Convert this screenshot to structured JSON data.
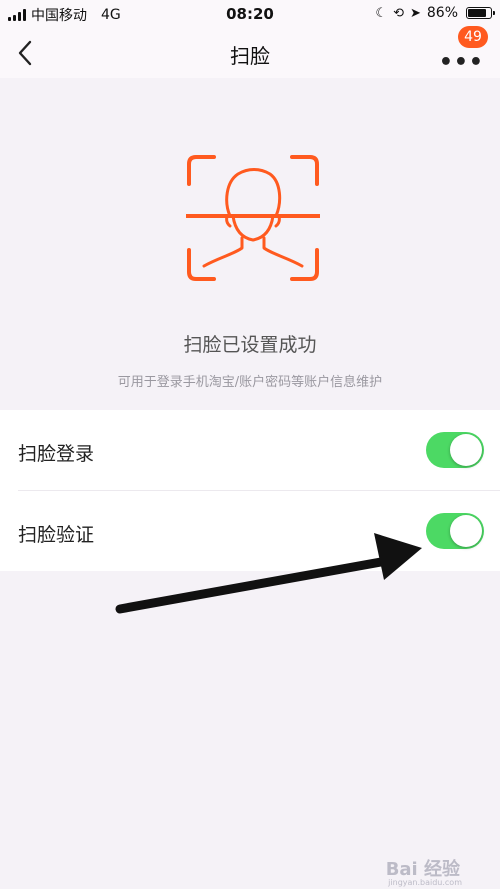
{
  "status_bar": {
    "carrier": "中国移动",
    "network": "4G",
    "time": "08:20",
    "battery": "86%",
    "battery_level": 0.86
  },
  "nav": {
    "title": "扫脸",
    "badge_count": "49"
  },
  "face_setup": {
    "title": "扫脸已设置成功",
    "subtitle": "可用于登录手机淘宝/账户密码等账户信息维护"
  },
  "settings": [
    {
      "label": "扫脸登录",
      "enabled": true
    },
    {
      "label": "扫脸验证",
      "enabled": true
    }
  ],
  "colors": {
    "accent": "#ff5a1f",
    "toggle_on": "#4cd964",
    "background": "#f5f2f7"
  },
  "watermark": {
    "text": "Bai 经验",
    "sub": "jingyan.baidu.com"
  }
}
